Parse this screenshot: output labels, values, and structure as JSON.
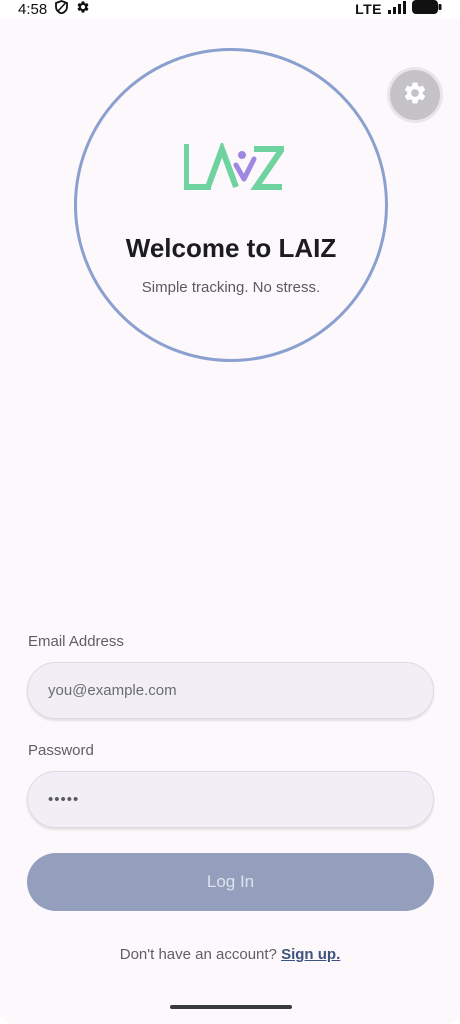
{
  "status_bar": {
    "time": "4:58",
    "network": "LTE",
    "icons": [
      "shield-icon",
      "gear-icon",
      "signal-icon",
      "battery-icon"
    ]
  },
  "hero": {
    "logo_text": "LAIZ",
    "title": "Welcome to LAIZ",
    "subtitle": "Simple tracking. No stress."
  },
  "form": {
    "email_label": "Email Address",
    "email_placeholder": "you@example.com",
    "password_label": "Password",
    "password_value": "•••••",
    "login_label": "Log In",
    "signup_prompt": "Don't have an account?",
    "signup_link": "Sign up."
  },
  "colors": {
    "background": "#fdf8fb",
    "circle_border": "#8aa0cf",
    "logo_green": "#6fd3a0",
    "logo_purple": "#9f86e0",
    "login_button": "#939fbd",
    "link": "#3e527e"
  }
}
